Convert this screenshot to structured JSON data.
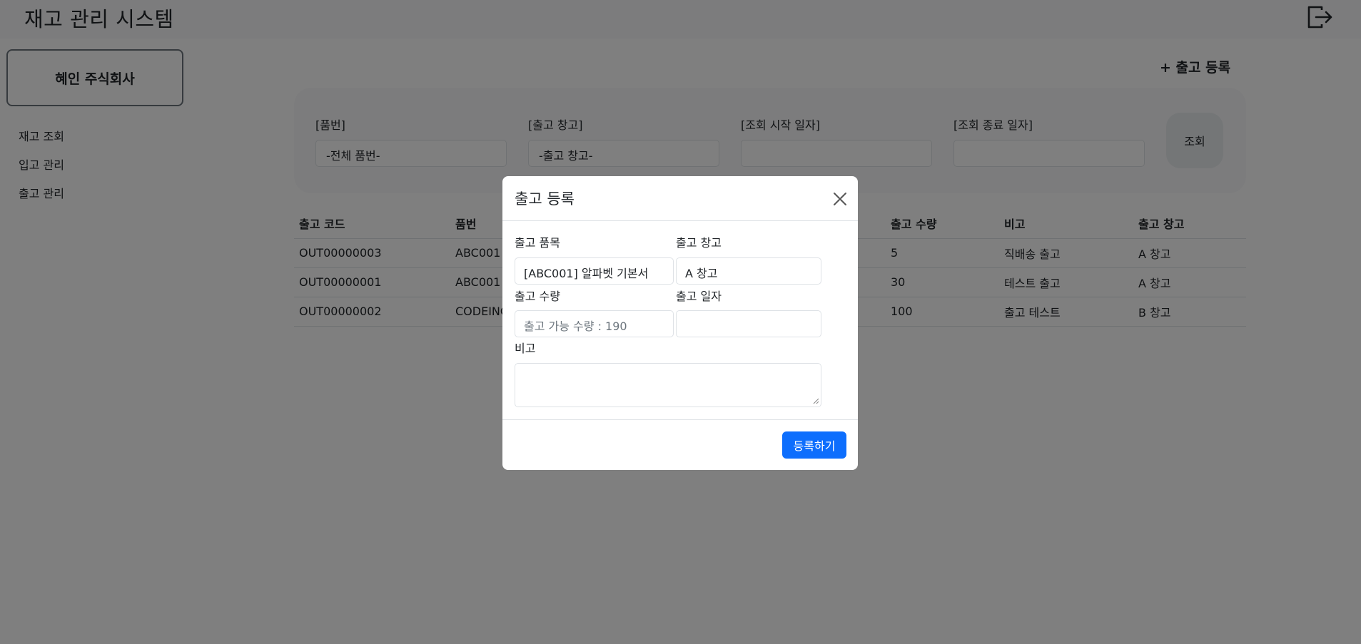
{
  "header": {
    "title": "재고 관리 시스템",
    "logout_icon": "logout-icon"
  },
  "sidebar": {
    "company": "혜인 주식회사",
    "items": [
      {
        "label": "재고 조회"
      },
      {
        "label": "입고 관리"
      },
      {
        "label": "출고 관리"
      }
    ]
  },
  "main": {
    "register_link": "+ 출고 등록",
    "filters": {
      "part_label": "[품번]",
      "part_value": "-전체 품번-",
      "warehouse_label": "[출고 창고]",
      "warehouse_value": "-출고 창고-",
      "start_label": "[조회 시작 일자]",
      "start_value": "",
      "end_label": "[조회 종료 일자]",
      "end_value": "",
      "search_button": "조회"
    },
    "table": {
      "headers": [
        "출고 코드",
        "품번",
        "출고 수량",
        "비고",
        "출고 창고"
      ],
      "rows": [
        [
          "OUT00000003",
          "ABC001",
          "5",
          "직배송 출고",
          "A 창고"
        ],
        [
          "OUT00000001",
          "ABC001",
          "30",
          "테스트 출고",
          "A 창고"
        ],
        [
          "OUT00000002",
          "CODEINC",
          "100",
          "출고 테스트",
          "B 창고"
        ]
      ]
    }
  },
  "modal": {
    "title": "출고 등록",
    "item_label": "출고 품목",
    "item_value": "[ABC001] 알파벳 기본서",
    "warehouse_label": "출고 창고",
    "warehouse_value": "A 창고",
    "qty_label": "출고 수량",
    "qty_placeholder": "출고 가능 수량 : 190",
    "date_label": "출고 일자",
    "date_value": "",
    "note_label": "비고",
    "note_value": "",
    "submit_label": "등록하기"
  },
  "colors": {
    "primary": "#0d6efd",
    "backdrop": "rgba(0,0,0,0.5)"
  }
}
